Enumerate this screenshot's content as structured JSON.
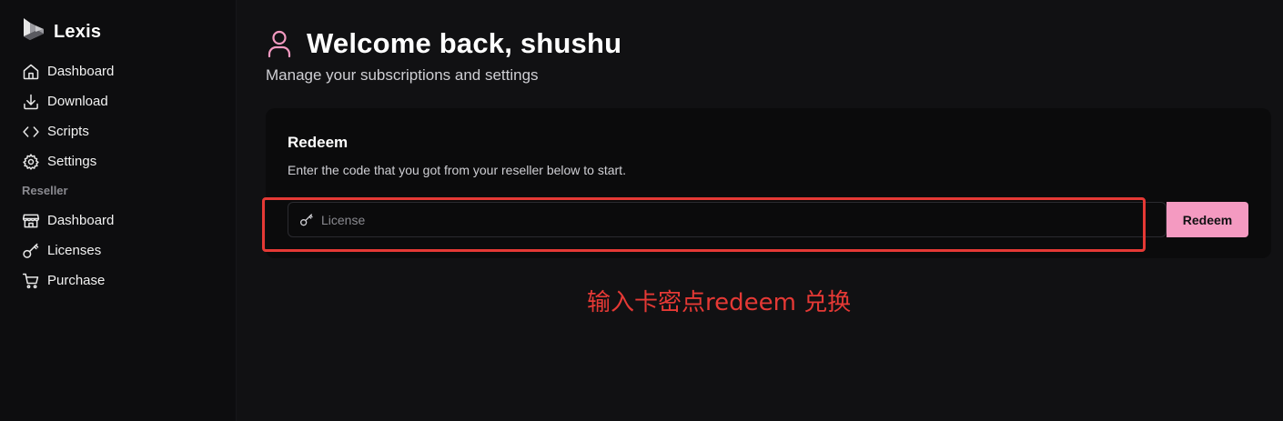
{
  "brand": {
    "name": "Lexis",
    "icon": "lexis-logo-icon"
  },
  "sidebar": {
    "items": [
      {
        "label": "Dashboard",
        "icon": "home-icon"
      },
      {
        "label": "Download",
        "icon": "download-icon"
      },
      {
        "label": "Scripts",
        "icon": "code-icon"
      },
      {
        "label": "Settings",
        "icon": "gear-icon"
      }
    ],
    "reseller_section": "Reseller",
    "reseller_items": [
      {
        "label": "Dashboard",
        "icon": "store-icon"
      },
      {
        "label": "Licenses",
        "icon": "key-icon"
      },
      {
        "label": "Purchase",
        "icon": "cart-icon"
      }
    ]
  },
  "header": {
    "title": "Welcome back, shushu",
    "subtitle": "Manage your subscriptions and settings",
    "icon": "user-icon"
  },
  "redeem_card": {
    "title": "Redeem",
    "description": "Enter the code that you got from your reseller below to start.",
    "input_placeholder": "License",
    "input_value": "",
    "button_label": "Redeem"
  },
  "annotation": {
    "text": "输入卡密点redeem 兑换"
  },
  "colors": {
    "accent": "#f49ac1",
    "background": "#111113",
    "sidebar": "#0d0d0f",
    "card": "#0b0b0c",
    "annotation": "#e53935"
  }
}
